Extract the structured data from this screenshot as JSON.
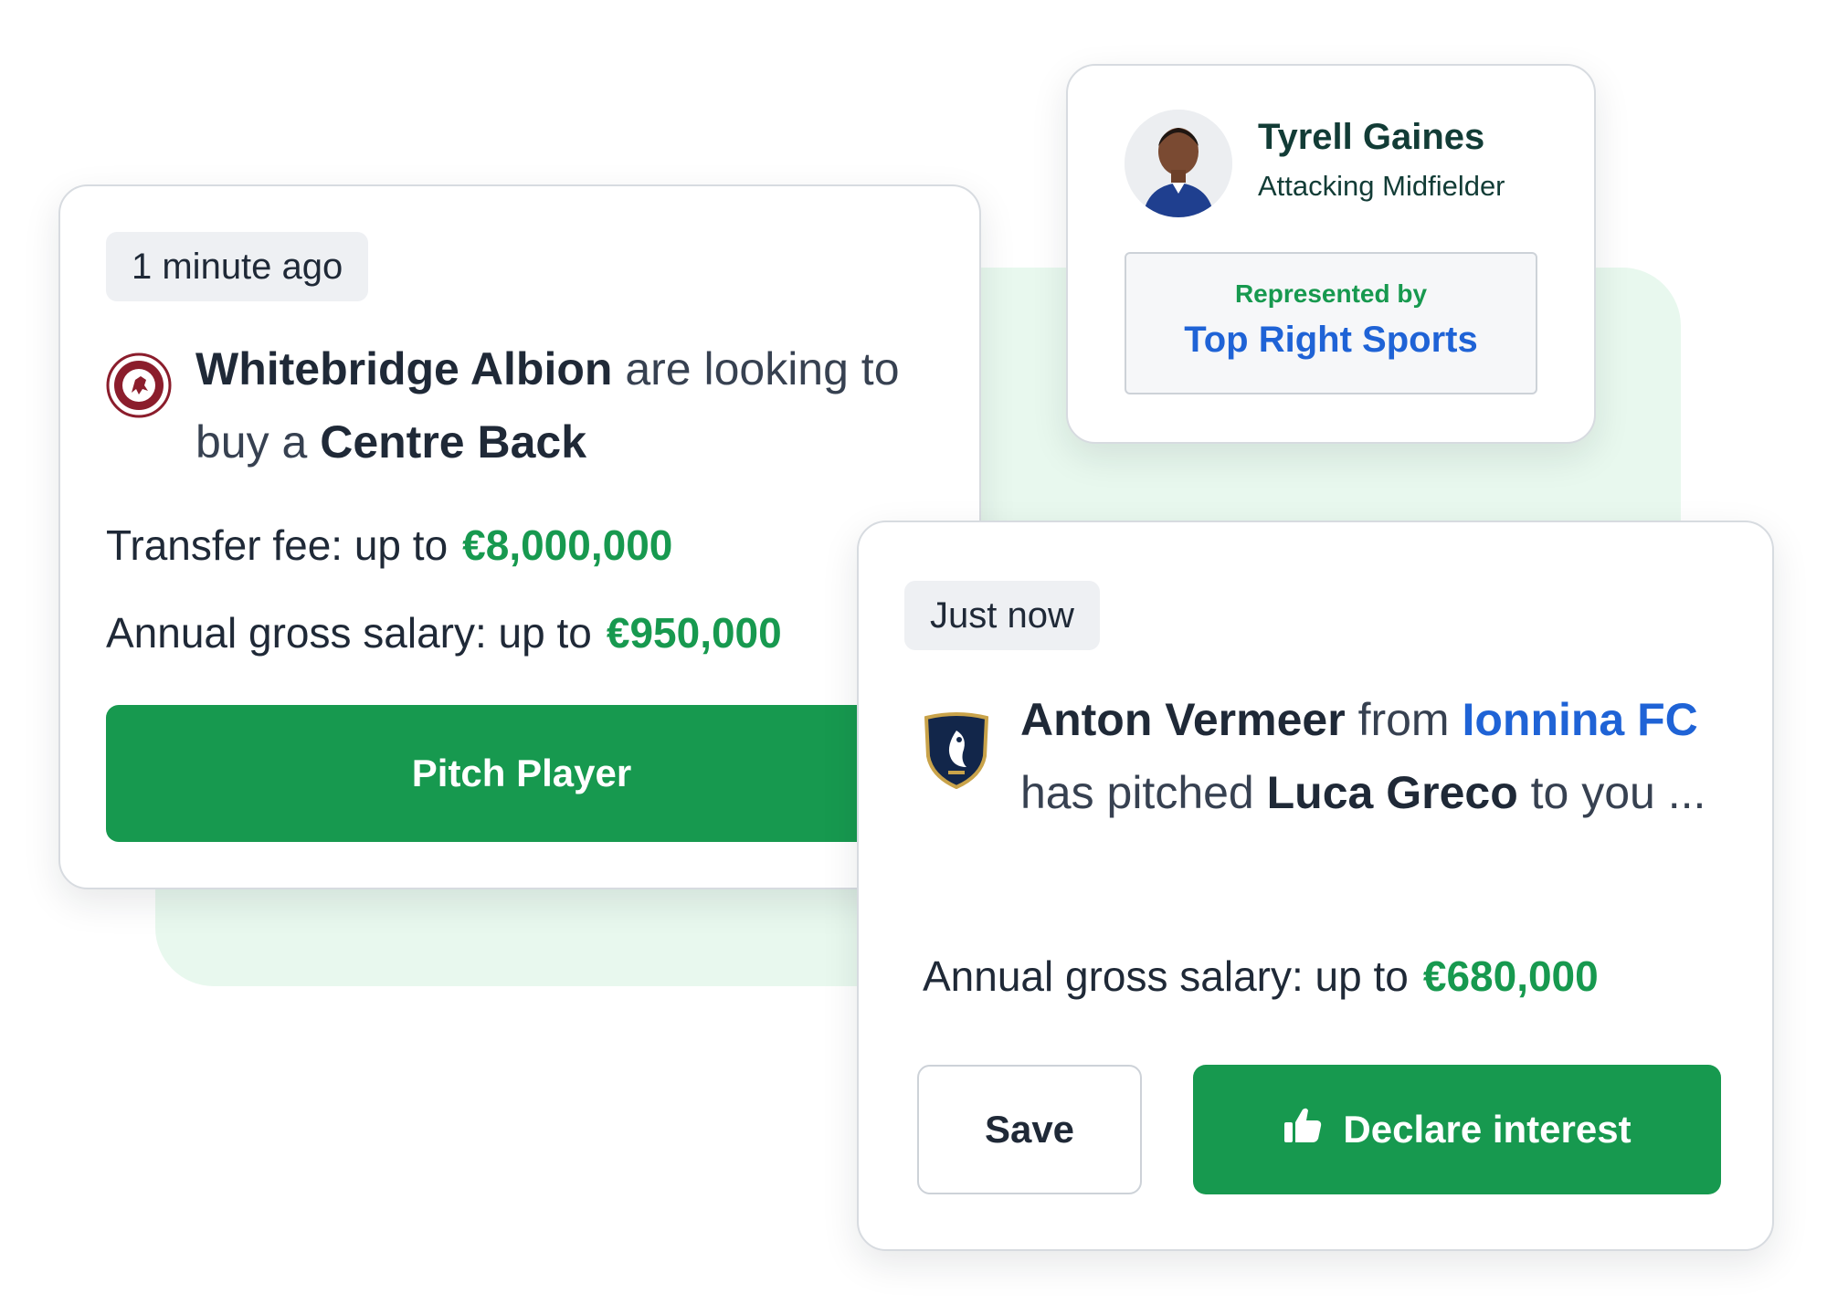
{
  "colors": {
    "accent_green": "#17994f",
    "link_blue": "#1f63d6",
    "card_border": "#d7dbe0",
    "backdrop": "#e8f8ee"
  },
  "buyer_card": {
    "time_badge": "1 minute ago",
    "club_crest_icon": "whitebridge-albion-crest-icon",
    "club_name": "Whitebridge Albion",
    "headline_middle": " are looking to buy a ",
    "position": "Centre Back",
    "fee_label": "Transfer fee: up to",
    "fee_value": "€8,000,000",
    "salary_label": "Annual gross salary: up to",
    "salary_value": "€950,000",
    "button_label": "Pitch Player"
  },
  "player_card": {
    "avatar_icon": "player-avatar",
    "name": "Tyrell Gaines",
    "position": "Attacking Midfielder",
    "represented_label": "Represented by",
    "agency": "Top Right Sports"
  },
  "pitch_card": {
    "time_badge": "Just now",
    "club_crest_icon": "ionnina-fc-crest-icon",
    "agent_name": "Anton Vermeer",
    "from_word": " from ",
    "club_name": "Ionnina FC",
    "pitched_text": " has pitched ",
    "player_name": "Luca Greco",
    "to_you_text": " to you ...",
    "salary_label": "Annual gross salary: up to",
    "salary_value": "€680,000",
    "save_label": "Save",
    "declare_icon": "thumbs-up-icon",
    "declare_label": "Declare interest"
  }
}
